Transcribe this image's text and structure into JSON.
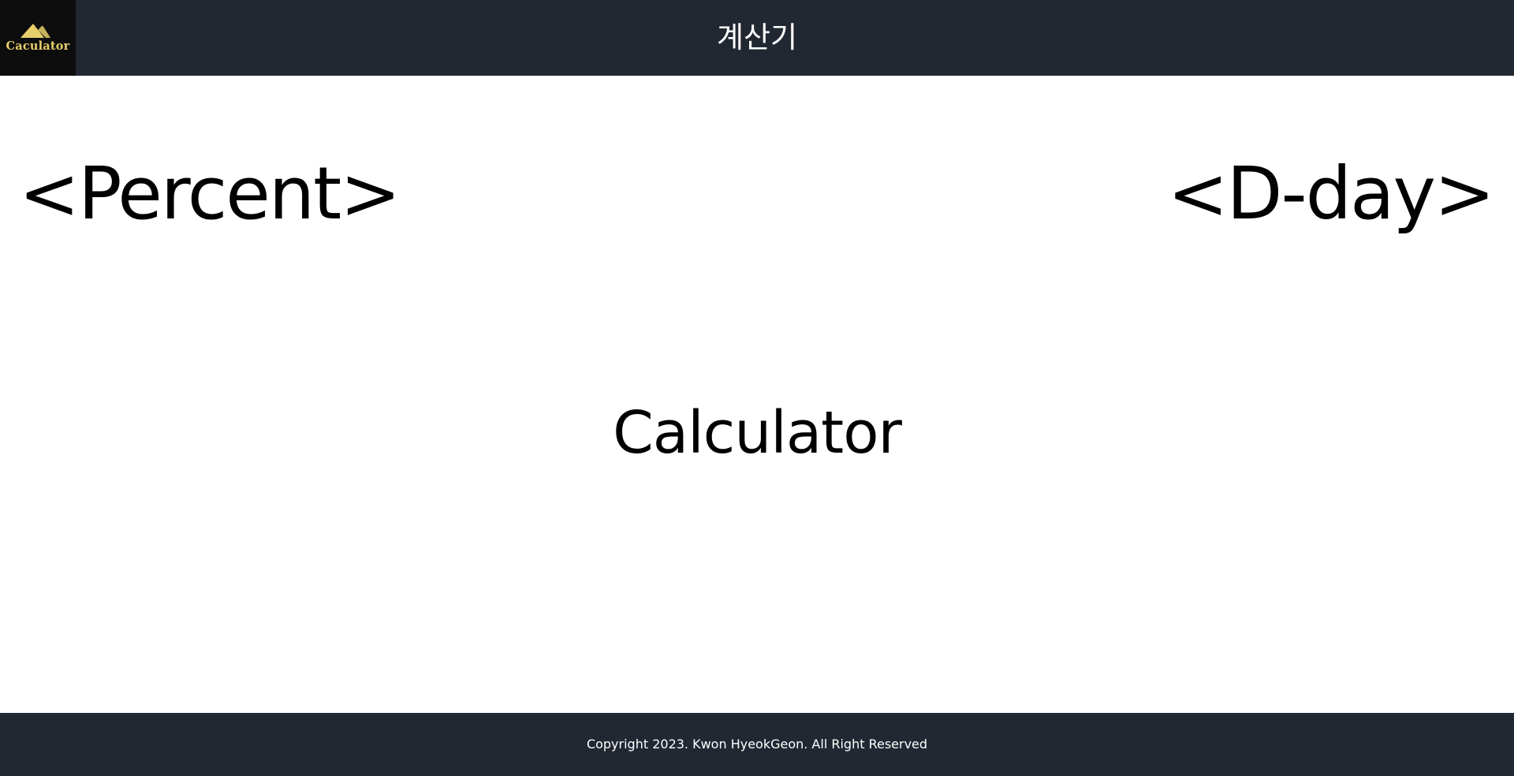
{
  "header": {
    "logo_text": "Caculator",
    "logo_icon": "mountain-icon",
    "title": "계산기"
  },
  "main": {
    "nav_percent": "<Percent>",
    "nav_dday": "<D-day>",
    "center_title": "Calculator"
  },
  "footer": {
    "copyright": "Copyright 2023. Kwon HyeokGeon. All Right Reserved"
  },
  "colors": {
    "header_bg": "#222832",
    "logo_bg": "#0d0d0d",
    "logo_gold": "#e8cf6b",
    "footer_bg": "#222832"
  }
}
